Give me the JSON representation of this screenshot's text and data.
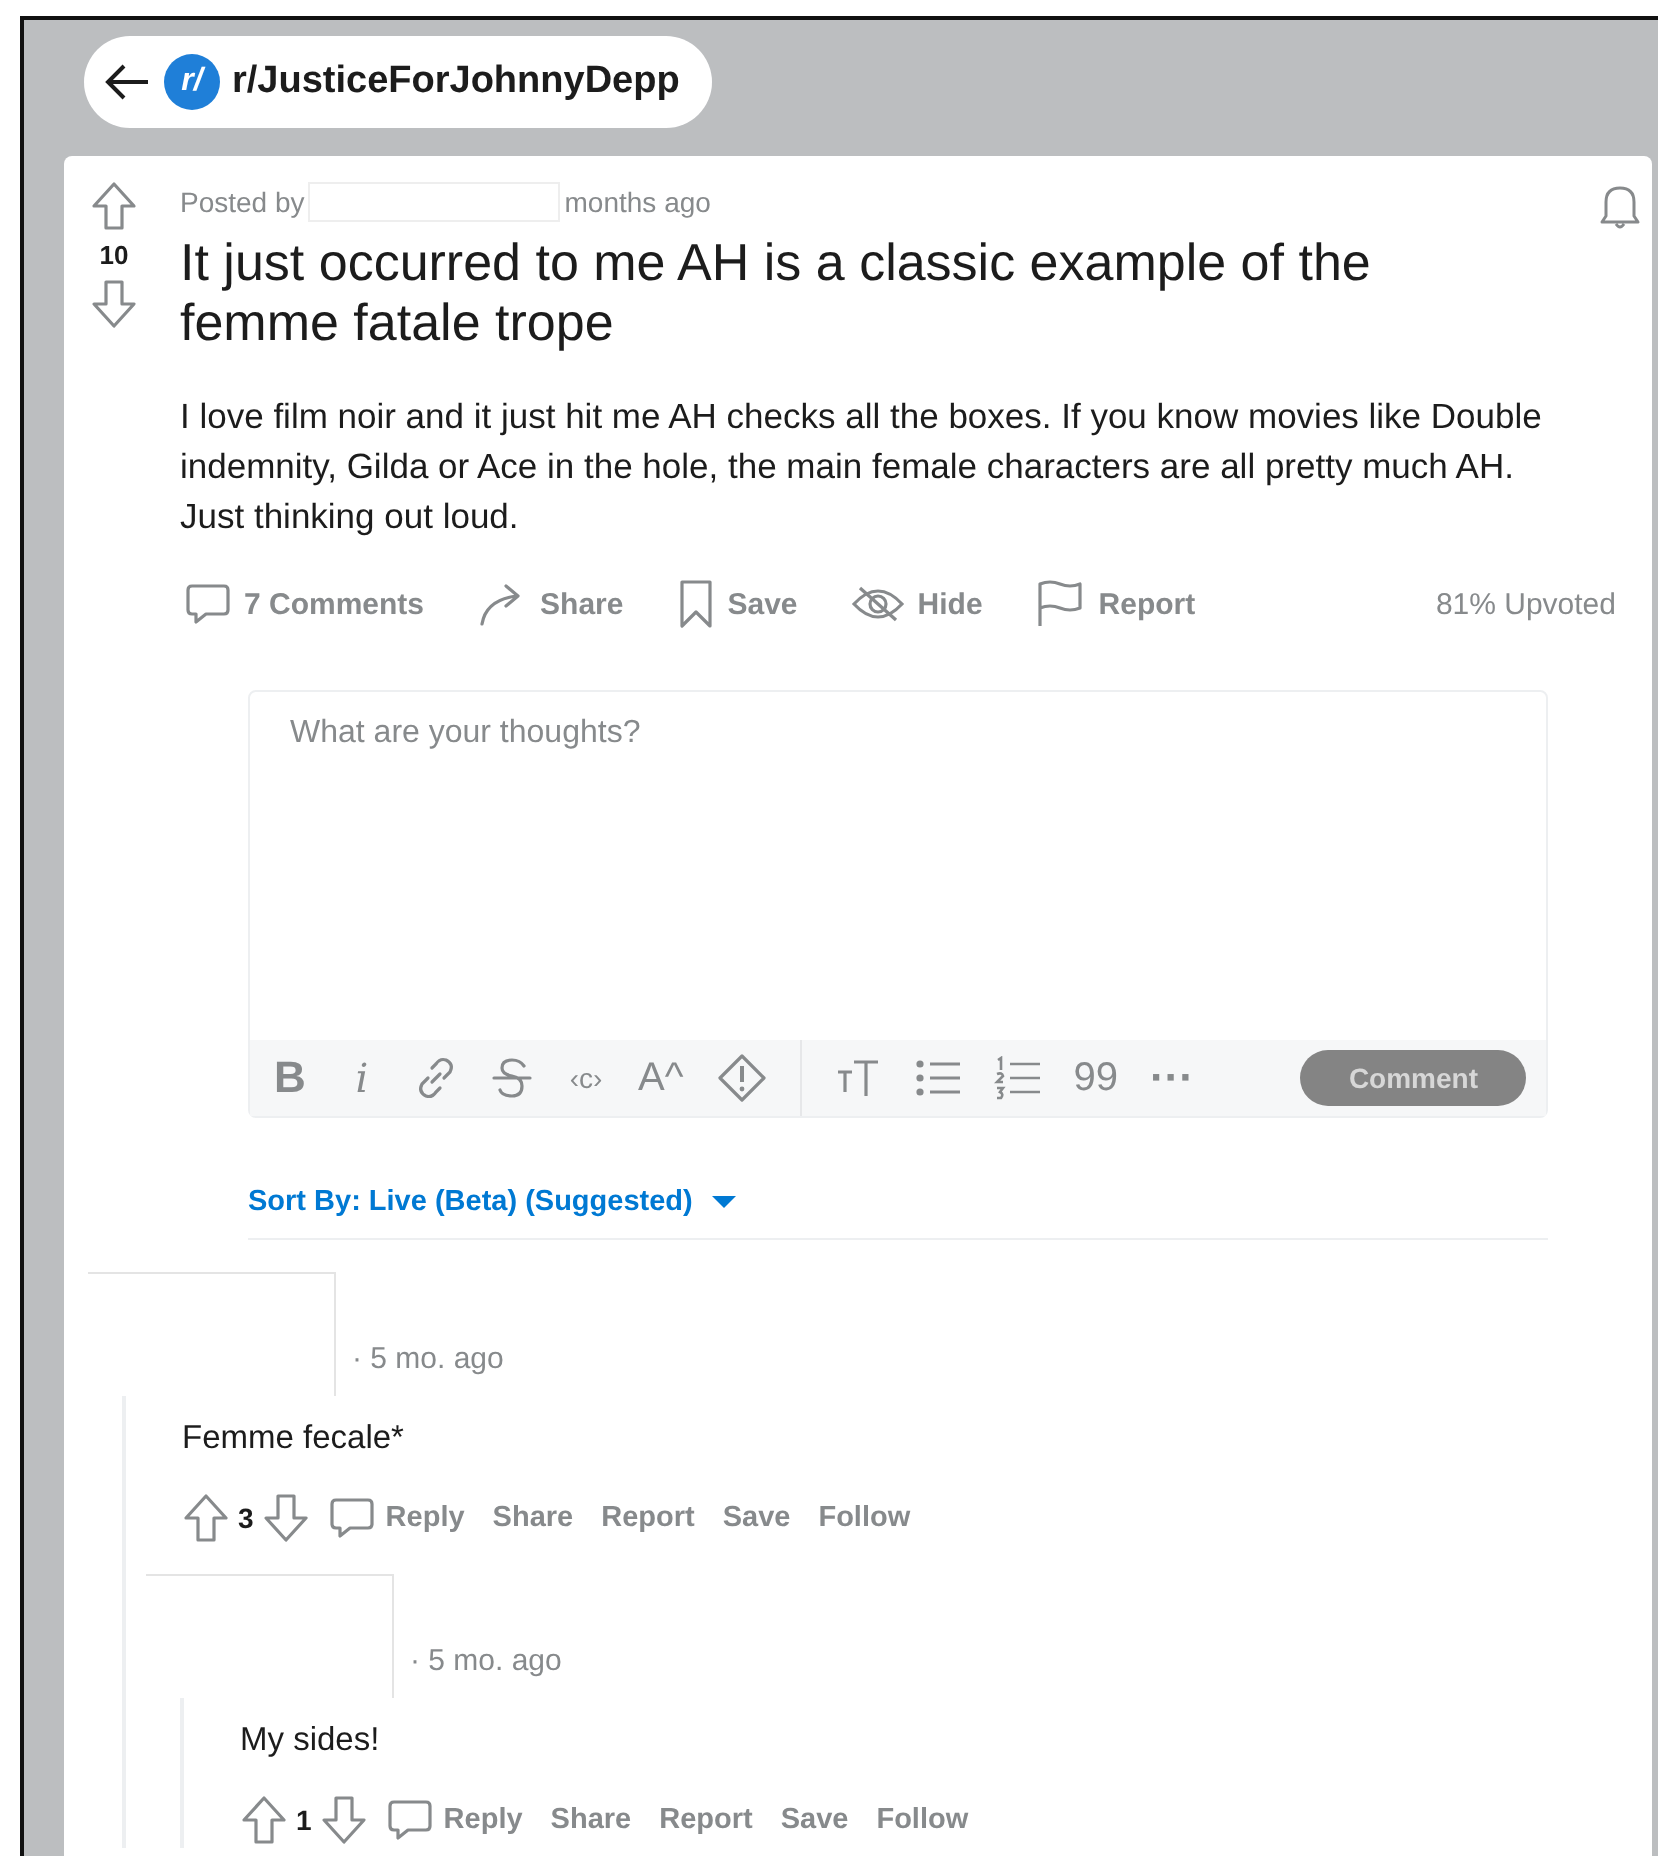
{
  "subreddit": {
    "avatar": "r/",
    "name": "r/JusticeForJohnnyDepp"
  },
  "post": {
    "score": "10",
    "posted_by": "Posted by",
    "age": "months ago",
    "title": "It just occurred to me AH is a classic example of the femme fatale trope",
    "body": "I love film noir and it just hit me AH checks all the boxes. If you know movies like Double indemnity, Gilda or Ace in the hole, the main female characters are all pretty much AH. Just thinking out loud.",
    "actions": [
      {
        "kind": "comments",
        "label": "7 Comments"
      },
      {
        "kind": "share",
        "label": "Share"
      },
      {
        "kind": "save",
        "label": "Save"
      },
      {
        "kind": "hide",
        "label": "Hide"
      },
      {
        "kind": "report",
        "label": "Report"
      }
    ],
    "upvoted": "81% Upvoted"
  },
  "editor": {
    "placeholder": "What are your thoughts?",
    "toolbar_groups": [
      [
        {
          "kind": "bold",
          "text": "B"
        },
        {
          "kind": "italic",
          "text": "i"
        },
        {
          "kind": "link"
        },
        {
          "kind": "strike"
        },
        {
          "kind": "code",
          "text": "‹c›"
        },
        {
          "kind": "superscript",
          "text": "A^"
        },
        {
          "kind": "spoiler"
        }
      ],
      [
        {
          "kind": "heading"
        },
        {
          "kind": "bullets"
        },
        {
          "kind": "numbers"
        },
        {
          "kind": "quote",
          "text": "99"
        },
        {
          "kind": "more",
          "text": "···"
        }
      ]
    ],
    "submit": {
      "label": "Comment",
      "disabled": true
    }
  },
  "sort": {
    "label": "Sort By: Live (Beta) (Suggested)"
  },
  "comments": [
    {
      "age": "· 5 mo. ago",
      "body": "Femme fecale*",
      "score": "3",
      "actions": [
        "Reply",
        "Share",
        "Report",
        "Save",
        "Follow"
      ],
      "children": [
        {
          "age": "· 5 mo. ago",
          "body": "My sides!",
          "score": "1",
          "actions": [
            "Reply",
            "Share",
            "Report",
            "Save",
            "Follow"
          ]
        }
      ]
    }
  ]
}
